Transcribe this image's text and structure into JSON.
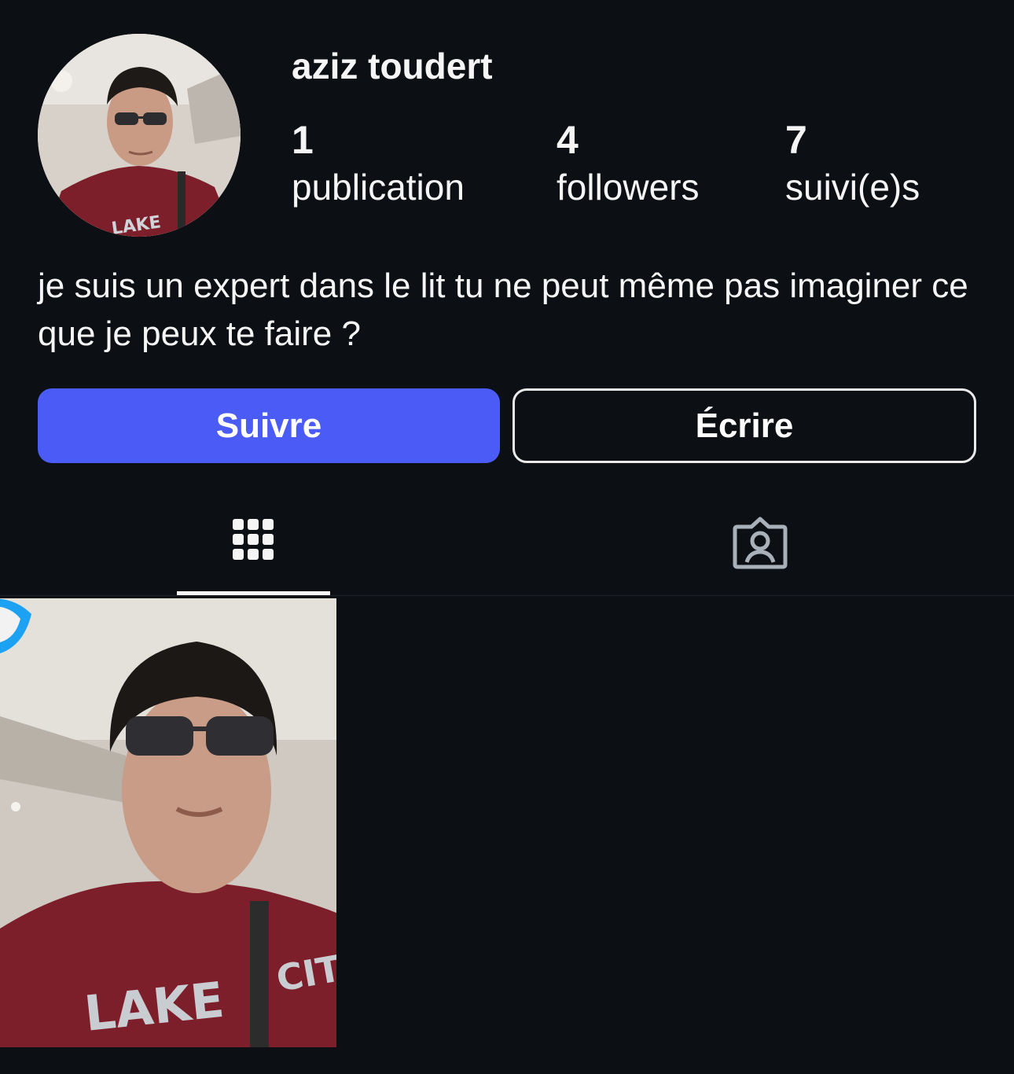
{
  "profile": {
    "username": "aziz toudert",
    "bio": "je suis un expert dans le lit tu ne peut même pas imaginer ce que je peux te faire ?",
    "avatar_icon": "profile-photo"
  },
  "stats": {
    "posts_count": "1",
    "posts_label": "publication",
    "followers_count": "4",
    "followers_label": "followers",
    "following_count": "7",
    "following_label": "suivi(e)s"
  },
  "actions": {
    "follow_label": "Suivre",
    "message_label": "Écrire"
  },
  "tabs": [
    {
      "icon": "grid-icon",
      "active": true
    },
    {
      "icon": "tagged-person-icon",
      "active": false
    }
  ],
  "posts": [
    {
      "icon": "photo-thumbnail"
    }
  ],
  "colors": {
    "background": "#0c1014",
    "follow_button": "#4b5cf6",
    "text": "#f5f5f5",
    "inactive_icon": "#a8b0b9"
  }
}
